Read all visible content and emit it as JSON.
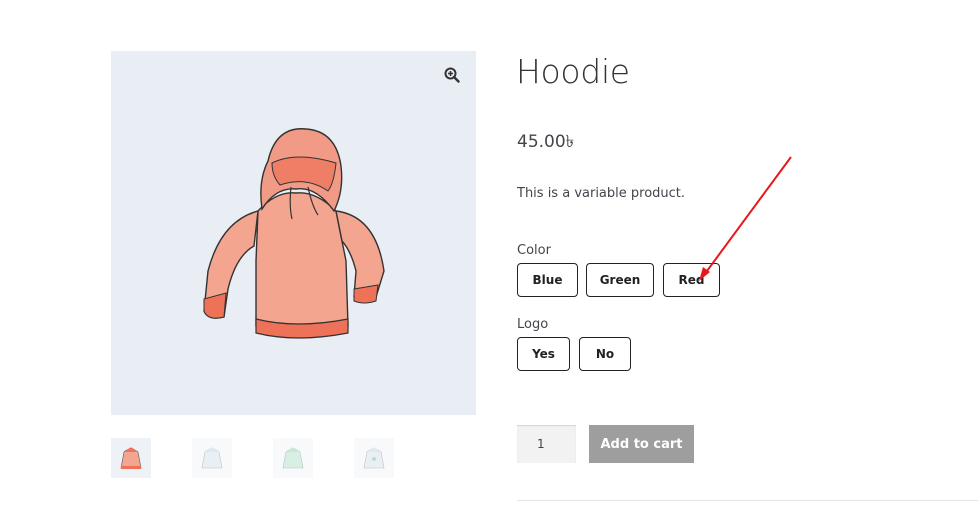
{
  "product": {
    "title": "Hoodie",
    "price": "45.00৳",
    "short_description": "This is a variable product."
  },
  "attributes": {
    "color": {
      "label": "Color",
      "options": [
        "Blue",
        "Green",
        "Red"
      ]
    },
    "logo": {
      "label": "Logo",
      "options": [
        "Yes",
        "No"
      ]
    }
  },
  "cart": {
    "quantity": "1",
    "add_to_cart_label": "Add to cart"
  },
  "gallery": {
    "zoom_icon": "magnifier-plus-icon",
    "thumbnails": [
      "hoodie-red",
      "hoodie-blue",
      "hoodie-green",
      "hoodie-blue-logo"
    ]
  },
  "colors": {
    "hoodie_fill": "#f4a590",
    "hoodie_band": "#ee7258",
    "image_bg": "#e9eef4",
    "button_disabled": "#9e9e9e",
    "annotation_arrow": "#e8171b"
  }
}
